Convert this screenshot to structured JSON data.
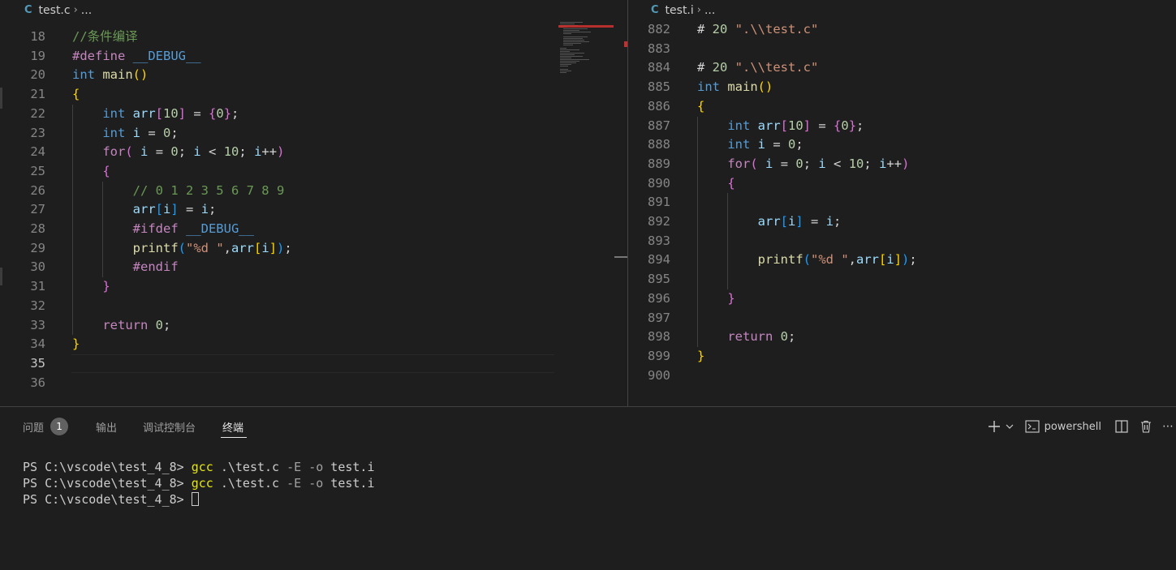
{
  "tabs": {
    "left_file": "test.c",
    "right_file": "test.i",
    "ellipsis": "..."
  },
  "left_editor": {
    "lines": [
      {
        "n": "18",
        "tokens": [
          [
            "cm",
            "//条件编译"
          ]
        ]
      },
      {
        "n": "19",
        "tokens": [
          [
            "pre",
            "#define "
          ],
          [
            "mac",
            "__DEBUG__"
          ]
        ]
      },
      {
        "n": "20",
        "tokens": [
          [
            "kw",
            "int "
          ],
          [
            "fn",
            "main"
          ],
          [
            "b1",
            "()"
          ]
        ]
      },
      {
        "n": "21",
        "tokens": [
          [
            "b1",
            "{"
          ]
        ]
      },
      {
        "n": "22",
        "tokens": [
          [
            "ws",
            "    "
          ],
          [
            "kw",
            "int "
          ],
          [
            "var",
            "arr"
          ],
          [
            "b2",
            "["
          ],
          [
            "num",
            "10"
          ],
          [
            "b2",
            "]"
          ],
          [
            "ws",
            " = "
          ],
          [
            "b2",
            "{"
          ],
          [
            "num",
            "0"
          ],
          [
            "b2",
            "}"
          ],
          [
            "ws",
            ";"
          ]
        ]
      },
      {
        "n": "23",
        "tokens": [
          [
            "ws",
            "    "
          ],
          [
            "kw",
            "int "
          ],
          [
            "var",
            "i"
          ],
          [
            "ws",
            " = "
          ],
          [
            "num",
            "0"
          ],
          [
            "ws",
            ";"
          ]
        ]
      },
      {
        "n": "24",
        "tokens": [
          [
            "ws",
            "    "
          ],
          [
            "ctrl",
            "for"
          ],
          [
            "b2",
            "("
          ],
          [
            "ws",
            " "
          ],
          [
            "var",
            "i"
          ],
          [
            "ws",
            " = "
          ],
          [
            "num",
            "0"
          ],
          [
            "ws",
            "; "
          ],
          [
            "var",
            "i"
          ],
          [
            "ws",
            " < "
          ],
          [
            "num",
            "10"
          ],
          [
            "ws",
            "; "
          ],
          [
            "var",
            "i"
          ],
          [
            "ws",
            "++"
          ],
          [
            "b2",
            ")"
          ]
        ]
      },
      {
        "n": "25",
        "tokens": [
          [
            "ws",
            "    "
          ],
          [
            "b2",
            "{"
          ]
        ]
      },
      {
        "n": "26",
        "tokens": [
          [
            "ws",
            "        "
          ],
          [
            "cm",
            "// 0 1 2 3 5 6 7 8 9"
          ]
        ]
      },
      {
        "n": "27",
        "tokens": [
          [
            "ws",
            "        "
          ],
          [
            "var",
            "arr"
          ],
          [
            "b3",
            "["
          ],
          [
            "var",
            "i"
          ],
          [
            "b3",
            "]"
          ],
          [
            "ws",
            " = "
          ],
          [
            "var",
            "i"
          ],
          [
            "ws",
            ";"
          ]
        ]
      },
      {
        "n": "28",
        "tokens": [
          [
            "ws",
            "        "
          ],
          [
            "pre",
            "#ifdef "
          ],
          [
            "mac",
            "__DEBUG__"
          ]
        ]
      },
      {
        "n": "29",
        "tokens": [
          [
            "ws",
            "        "
          ],
          [
            "fn",
            "printf"
          ],
          [
            "b3",
            "("
          ],
          [
            "str",
            "\"%d \""
          ],
          [
            "ws",
            ","
          ],
          [
            "var",
            "arr"
          ],
          [
            "b1",
            "["
          ],
          [
            "var",
            "i"
          ],
          [
            "b1",
            "]"
          ],
          [
            "b3",
            ")"
          ],
          [
            "ws",
            ";"
          ]
        ]
      },
      {
        "n": "30",
        "tokens": [
          [
            "ws",
            "        "
          ],
          [
            "pre",
            "#endif"
          ]
        ]
      },
      {
        "n": "31",
        "tokens": [
          [
            "ws",
            "    "
          ],
          [
            "b2",
            "}"
          ]
        ]
      },
      {
        "n": "32",
        "tokens": []
      },
      {
        "n": "33",
        "tokens": [
          [
            "ws",
            "    "
          ],
          [
            "ctrl",
            "return "
          ],
          [
            "num",
            "0"
          ],
          [
            "ws",
            ";"
          ]
        ]
      },
      {
        "n": "34",
        "tokens": [
          [
            "b1",
            "}"
          ]
        ]
      },
      {
        "n": "35",
        "tokens": []
      },
      {
        "n": "36",
        "tokens": []
      }
    ],
    "active_line": "35"
  },
  "right_editor": {
    "lines": [
      {
        "n": "882",
        "tokens": [
          [
            "ws",
            "# "
          ],
          [
            "num",
            "20 "
          ],
          [
            "str",
            "\".\\\\test.c\""
          ]
        ]
      },
      {
        "n": "883",
        "tokens": []
      },
      {
        "n": "884",
        "tokens": [
          [
            "ws",
            "# "
          ],
          [
            "num",
            "20 "
          ],
          [
            "str",
            "\".\\\\test.c\""
          ]
        ]
      },
      {
        "n": "885",
        "tokens": [
          [
            "kw",
            "int "
          ],
          [
            "fn",
            "main"
          ],
          [
            "b1",
            "()"
          ]
        ]
      },
      {
        "n": "886",
        "tokens": [
          [
            "b1",
            "{"
          ]
        ]
      },
      {
        "n": "887",
        "tokens": [
          [
            "ws",
            "    "
          ],
          [
            "kw",
            "int "
          ],
          [
            "var",
            "arr"
          ],
          [
            "b2",
            "["
          ],
          [
            "num",
            "10"
          ],
          [
            "b2",
            "]"
          ],
          [
            "ws",
            " = "
          ],
          [
            "b2",
            "{"
          ],
          [
            "num",
            "0"
          ],
          [
            "b2",
            "}"
          ],
          [
            "ws",
            ";"
          ]
        ]
      },
      {
        "n": "888",
        "tokens": [
          [
            "ws",
            "    "
          ],
          [
            "kw",
            "int "
          ],
          [
            "var",
            "i"
          ],
          [
            "ws",
            " = "
          ],
          [
            "num",
            "0"
          ],
          [
            "ws",
            ";"
          ]
        ]
      },
      {
        "n": "889",
        "tokens": [
          [
            "ws",
            "    "
          ],
          [
            "ctrl",
            "for"
          ],
          [
            "b2",
            "("
          ],
          [
            "ws",
            " "
          ],
          [
            "var",
            "i"
          ],
          [
            "ws",
            " = "
          ],
          [
            "num",
            "0"
          ],
          [
            "ws",
            "; "
          ],
          [
            "var",
            "i"
          ],
          [
            "ws",
            " < "
          ],
          [
            "num",
            "10"
          ],
          [
            "ws",
            "; "
          ],
          [
            "var",
            "i"
          ],
          [
            "ws",
            "++"
          ],
          [
            "b2",
            ")"
          ]
        ]
      },
      {
        "n": "890",
        "tokens": [
          [
            "ws",
            "    "
          ],
          [
            "b2",
            "{"
          ]
        ]
      },
      {
        "n": "891",
        "tokens": []
      },
      {
        "n": "892",
        "tokens": [
          [
            "ws",
            "        "
          ],
          [
            "var",
            "arr"
          ],
          [
            "b3",
            "["
          ],
          [
            "var",
            "i"
          ],
          [
            "b3",
            "]"
          ],
          [
            "ws",
            " = "
          ],
          [
            "var",
            "i"
          ],
          [
            "ws",
            ";"
          ]
        ]
      },
      {
        "n": "893",
        "tokens": []
      },
      {
        "n": "894",
        "tokens": [
          [
            "ws",
            "        "
          ],
          [
            "fn",
            "printf"
          ],
          [
            "b3",
            "("
          ],
          [
            "str",
            "\"%d \""
          ],
          [
            "ws",
            ","
          ],
          [
            "var",
            "arr"
          ],
          [
            "b1",
            "["
          ],
          [
            "var",
            "i"
          ],
          [
            "b1",
            "]"
          ],
          [
            "b3",
            ")"
          ],
          [
            "ws",
            ";"
          ]
        ]
      },
      {
        "n": "895",
        "tokens": []
      },
      {
        "n": "896",
        "tokens": [
          [
            "ws",
            "    "
          ],
          [
            "b2",
            "}"
          ]
        ]
      },
      {
        "n": "897",
        "tokens": []
      },
      {
        "n": "898",
        "tokens": [
          [
            "ws",
            "    "
          ],
          [
            "ctrl",
            "return "
          ],
          [
            "num",
            "0"
          ],
          [
            "ws",
            ";"
          ]
        ]
      },
      {
        "n": "899",
        "tokens": [
          [
            "b1",
            "}"
          ]
        ]
      },
      {
        "n": "900",
        "tokens": []
      }
    ]
  },
  "panel": {
    "tabs": {
      "problems": "问题",
      "problems_count": "1",
      "output": "输出",
      "debug_console": "调试控制台",
      "terminal": "终端"
    },
    "actions": {
      "shell_name": "powershell"
    },
    "terminal": {
      "prompt": "PS C:\\vscode\\test_4_8> ",
      "lines": [
        {
          "cmd": "gcc",
          "arg1": " .\\test.c ",
          "flag1": "-E",
          "mid": " ",
          "flag2": "-o",
          "arg2": " test.i"
        },
        {
          "cmd": "gcc",
          "arg1": " .\\test.c ",
          "flag1": "-E",
          "mid": " ",
          "flag2": "-o",
          "arg2": " test.i"
        }
      ]
    }
  },
  "colors": {
    "background": "#1e1e1e",
    "keyword": "#569cd6",
    "control": "#c586c0",
    "function": "#dcdcaa",
    "variable": "#9cdcfe",
    "number": "#b5cea8",
    "string": "#ce9178",
    "comment": "#6a9955",
    "bracket1": "#ffd700",
    "bracket2": "#da70d6",
    "bracket3": "#179fff"
  }
}
